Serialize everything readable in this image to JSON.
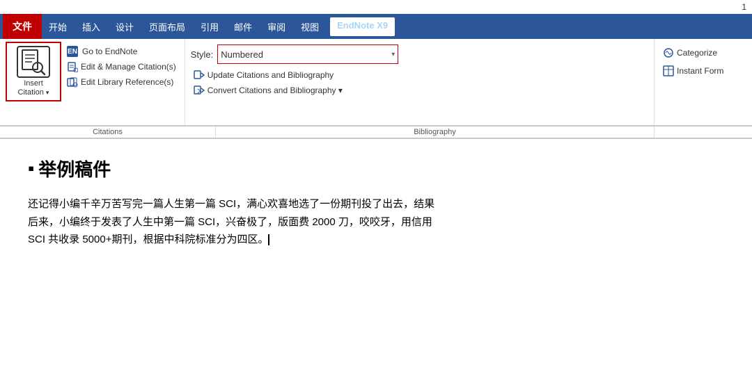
{
  "topbar": {
    "page_number": "1"
  },
  "menubar": {
    "file_label": "文件",
    "items": [
      {
        "label": "开始",
        "active": false
      },
      {
        "label": "插入",
        "active": false
      },
      {
        "label": "设计",
        "active": false
      },
      {
        "label": "页面布局",
        "active": false
      },
      {
        "label": "引用",
        "active": false
      },
      {
        "label": "邮件",
        "active": false
      },
      {
        "label": "审阅",
        "active": false
      },
      {
        "label": "视图",
        "active": false
      },
      {
        "label": "EndNote X9",
        "active": true,
        "endnote": true
      }
    ]
  },
  "ribbon": {
    "insert_citation": {
      "label_line1": "Insert",
      "label_line2": "Citation",
      "dropdown_arrow": "▾"
    },
    "small_buttons": [
      {
        "icon": "EN",
        "label": "Go to EndNote"
      },
      {
        "icon": "⁋",
        "label": "Edit & Manage Citation(s)"
      },
      {
        "icon": "◫",
        "label": "Edit Library Reference(s)"
      }
    ],
    "citations_section_label": "Citations",
    "style": {
      "label": "Style:",
      "value": "Numbered",
      "arrow": "▾"
    },
    "mid_buttons": [
      {
        "icon": "↻",
        "label": "Update Citations and Bibliography"
      },
      {
        "icon": "↺",
        "label": "Convert Citations and Bibliography ▾"
      }
    ],
    "bibliography_section_label": "Bibliography",
    "right_buttons": [
      {
        "icon": "⚙",
        "label": "Categorize"
      },
      {
        "icon": "▦",
        "label": "Instant Form"
      }
    ]
  },
  "document": {
    "title": "举例稿件",
    "paragraph1": "还记得小编千辛万苦写完一篇人生第一篇 SCI，满心欢喜地选了一份期刊投了出去，结果",
    "paragraph2": "后来，小编终于发表了人生中第一篇 SCI，兴奋极了，版面费 2000 刀，咬咬牙，用信用",
    "paragraph3": "SCI 共收录 5000+期刊，根据中科院标准分为四区。"
  }
}
